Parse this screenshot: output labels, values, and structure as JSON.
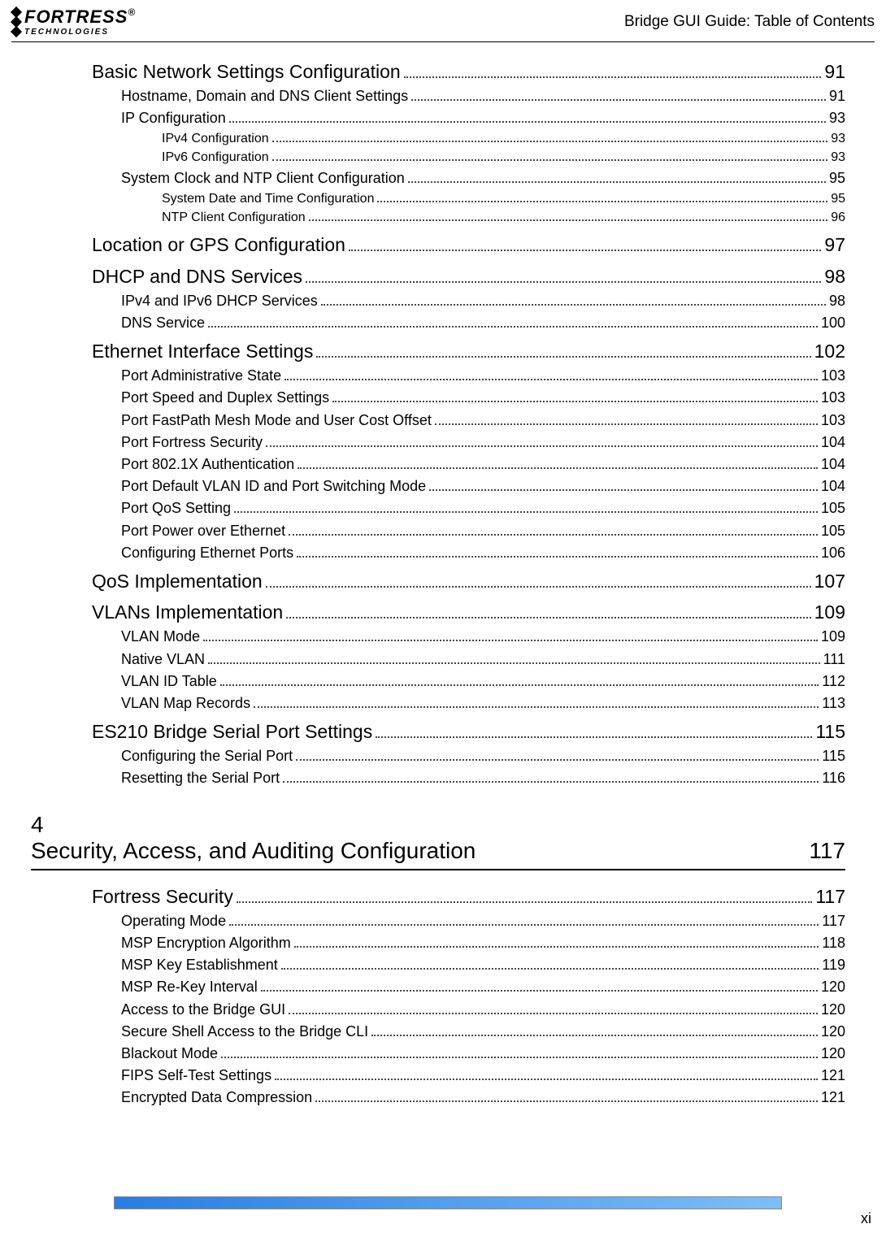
{
  "header": {
    "brand_name": "FORTRESS",
    "brand_sub": "TECHNOLOGIES",
    "brand_reg": "®",
    "right": "Bridge GUI Guide: Table of Contents"
  },
  "toc": [
    {
      "level": 1,
      "label": "Basic Network Settings Configuration",
      "page": "91"
    },
    {
      "level": 2,
      "label": "Hostname, Domain and DNS Client Settings",
      "page": "91"
    },
    {
      "level": 2,
      "label": "IP Configuration",
      "page": "93"
    },
    {
      "level": 3,
      "label": "IPv4 Configuration",
      "page": "93"
    },
    {
      "level": 3,
      "label": "IPv6 Configuration",
      "page": "93"
    },
    {
      "level": 2,
      "label": "System Clock and NTP Client Configuration",
      "page": "95"
    },
    {
      "level": 3,
      "label": "System Date and Time Configuration",
      "page": "95"
    },
    {
      "level": 3,
      "label": "NTP Client Configuration",
      "page": "96"
    },
    {
      "level": 1,
      "label": "Location or GPS Configuration",
      "page": "97"
    },
    {
      "level": 1,
      "label": "DHCP and DNS Services",
      "page": "98"
    },
    {
      "level": 2,
      "label": "IPv4 and IPv6 DHCP Services",
      "page": "98"
    },
    {
      "level": 2,
      "label": "DNS Service",
      "page": "100"
    },
    {
      "level": 1,
      "label": "Ethernet Interface Settings",
      "page": "102"
    },
    {
      "level": 2,
      "label": "Port Administrative State",
      "page": "103"
    },
    {
      "level": 2,
      "label": "Port Speed and Duplex Settings",
      "page": "103"
    },
    {
      "level": 2,
      "label": "Port FastPath Mesh Mode and User Cost Offset",
      "page": "103"
    },
    {
      "level": 2,
      "label": "Port Fortress Security",
      "page": "104"
    },
    {
      "level": 2,
      "label": "Port 802.1X Authentication",
      "page": "104"
    },
    {
      "level": 2,
      "label": "Port Default VLAN ID and Port Switching Mode",
      "page": "104"
    },
    {
      "level": 2,
      "label": "Port QoS Setting",
      "page": "105"
    },
    {
      "level": 2,
      "label": "Port Power over Ethernet",
      "page": "105"
    },
    {
      "level": 2,
      "label": "Configuring Ethernet Ports",
      "page": "106"
    },
    {
      "level": 1,
      "label": "QoS Implementation",
      "page": "107"
    },
    {
      "level": 1,
      "label": "VLANs Implementation",
      "page": "109"
    },
    {
      "level": 2,
      "label": "VLAN Mode",
      "page": "109"
    },
    {
      "level": 2,
      "label": "Native VLAN",
      "page": "111"
    },
    {
      "level": 2,
      "label": "VLAN ID Table",
      "page": "112"
    },
    {
      "level": 2,
      "label": "VLAN Map Records",
      "page": "113"
    },
    {
      "level": 1,
      "label": "ES210 Bridge Serial Port Settings",
      "page": "115"
    },
    {
      "level": 2,
      "label": "Configuring the Serial Port",
      "page": "115"
    },
    {
      "level": 2,
      "label": "Resetting the Serial Port",
      "page": "116"
    }
  ],
  "chapter": {
    "num": "4",
    "title": "Security, Access, and Auditing Configuration",
    "page": "117"
  },
  "toc2": [
    {
      "level": 1,
      "label": "Fortress Security",
      "page": "117"
    },
    {
      "level": 2,
      "label": "Operating Mode",
      "page": "117"
    },
    {
      "level": 2,
      "label": "MSP Encryption Algorithm",
      "page": "118"
    },
    {
      "level": 2,
      "label": "MSP Key Establishment",
      "page": "119"
    },
    {
      "level": 2,
      "label": "MSP Re-Key Interval",
      "page": "120"
    },
    {
      "level": 2,
      "label": "Access to the Bridge GUI",
      "page": "120"
    },
    {
      "level": 2,
      "label": "Secure Shell Access to the Bridge CLI",
      "page": "120"
    },
    {
      "level": 2,
      "label": "Blackout Mode",
      "page": "120"
    },
    {
      "level": 2,
      "label": "FIPS Self-Test Settings",
      "page": "121"
    },
    {
      "level": 2,
      "label": "Encrypted Data Compression",
      "page": "121"
    }
  ],
  "footer": {
    "page_num": "xi"
  }
}
